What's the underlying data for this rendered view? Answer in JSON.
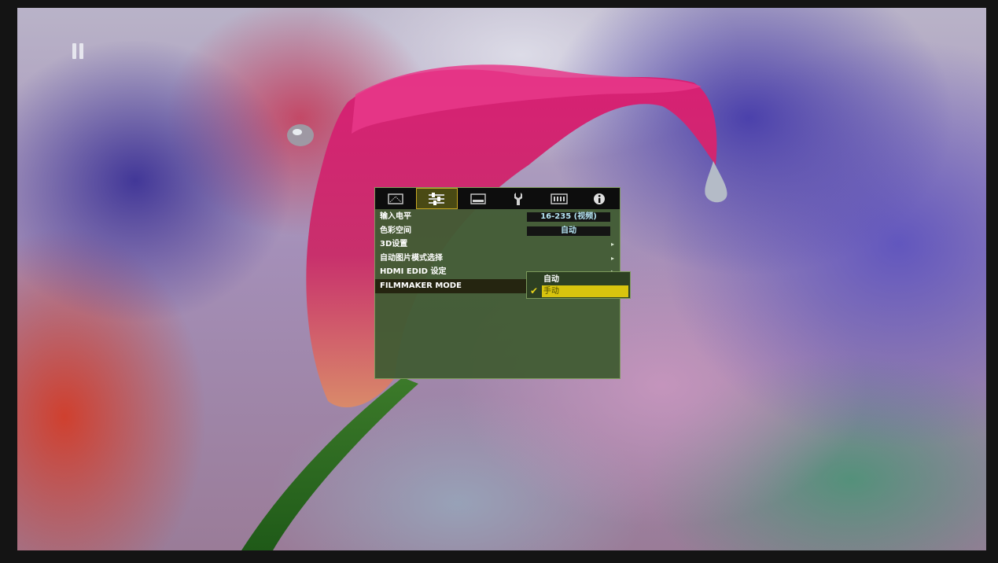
{
  "menu": {
    "tabs": [
      {
        "icon": "picture-icon",
        "active": false
      },
      {
        "icon": "settings-sliders-icon",
        "active": true
      },
      {
        "icon": "display-icon",
        "active": false
      },
      {
        "icon": "wrench-icon",
        "active": false
      },
      {
        "icon": "keyboard-icon",
        "active": false
      },
      {
        "icon": "info-icon",
        "active": false
      }
    ],
    "items": [
      {
        "label": "输入电平",
        "value": "16-235 (视频)"
      },
      {
        "label": "色彩空间",
        "value": "自动"
      },
      {
        "label": "3D设置",
        "arrow": "▸"
      },
      {
        "label": "自动图片模式选择",
        "arrow": "▸"
      },
      {
        "label": "HDMI EDID 设定",
        "arrow": "▸"
      },
      {
        "label": "FILMMAKER MODE"
      }
    ],
    "selected_item": "FILMMAKER MODE"
  },
  "dropdown": {
    "options": [
      "自动",
      "手动"
    ],
    "selected": "手动",
    "check_mark": "✔"
  },
  "colors": {
    "menu_bg": "#425c34",
    "highlight": "#d8c40e",
    "value_text": "#b4e3f2"
  }
}
